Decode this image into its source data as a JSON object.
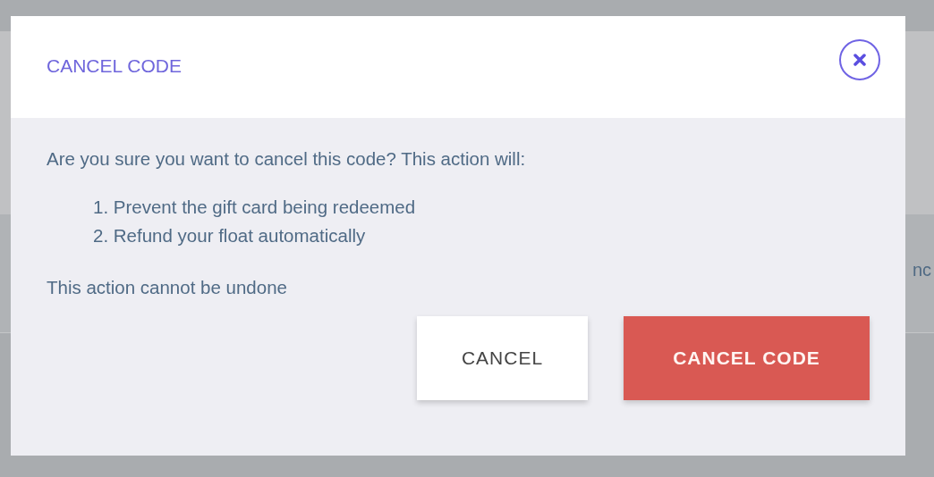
{
  "background": {
    "text": "nc"
  },
  "dialog": {
    "title": "CANCEL CODE",
    "message": "Are you sure you want to cancel this code? This action will:",
    "steps": [
      "1. Prevent the gift card being redeemed",
      "2. Refund your float automatically"
    ],
    "warning": "This action cannot be undone",
    "buttons": [
      {
        "label": "CANCEL",
        "kind": "secondary"
      },
      {
        "label": "CANCEL CODE",
        "kind": "danger"
      }
    ]
  }
}
